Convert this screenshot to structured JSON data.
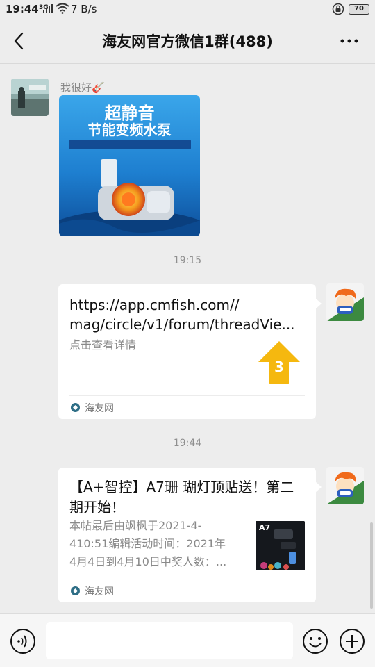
{
  "status_bar": {
    "time": "19:44",
    "signal_label": "3G",
    "net_speed": "7 B/s",
    "battery": "70"
  },
  "header": {
    "title": "海友网官方微信1群(488)"
  },
  "messages": {
    "first": {
      "sender_name": "我很好🎸",
      "image_caption_line1": "超静音",
      "image_caption_line2": "节能变频水泵"
    },
    "timestamp_1": "19:15",
    "link_card": {
      "url_line1": "https://app.cmfish.com//",
      "url_line2": "mag/circle/v1/forum/threadVie...",
      "description": "点击查看详情",
      "thumb_number": "3",
      "source": "海友网"
    },
    "timestamp_2": "19:44",
    "article_card": {
      "title": "【A+智控】A7珊 瑚灯顶贴送！第二期开始！",
      "desc_line1": "本帖最后由飒枫于2021-4-",
      "desc_line2": "410:51编辑活动时间：2021年",
      "desc_line3": "4月4日到4月10日中奖人数：...",
      "thumb_label": "A7",
      "source": "海友网"
    }
  },
  "icons": {
    "back": "chevron-left-icon",
    "more": "more-dots-icon",
    "voice": "voice-icon",
    "emoji": "emoji-icon",
    "plus": "plus-icon"
  },
  "colors": {
    "background": "#ededed",
    "card": "#ffffff",
    "source_icon": "#2e6e86",
    "thumb_arrow": "#f5b80f"
  }
}
